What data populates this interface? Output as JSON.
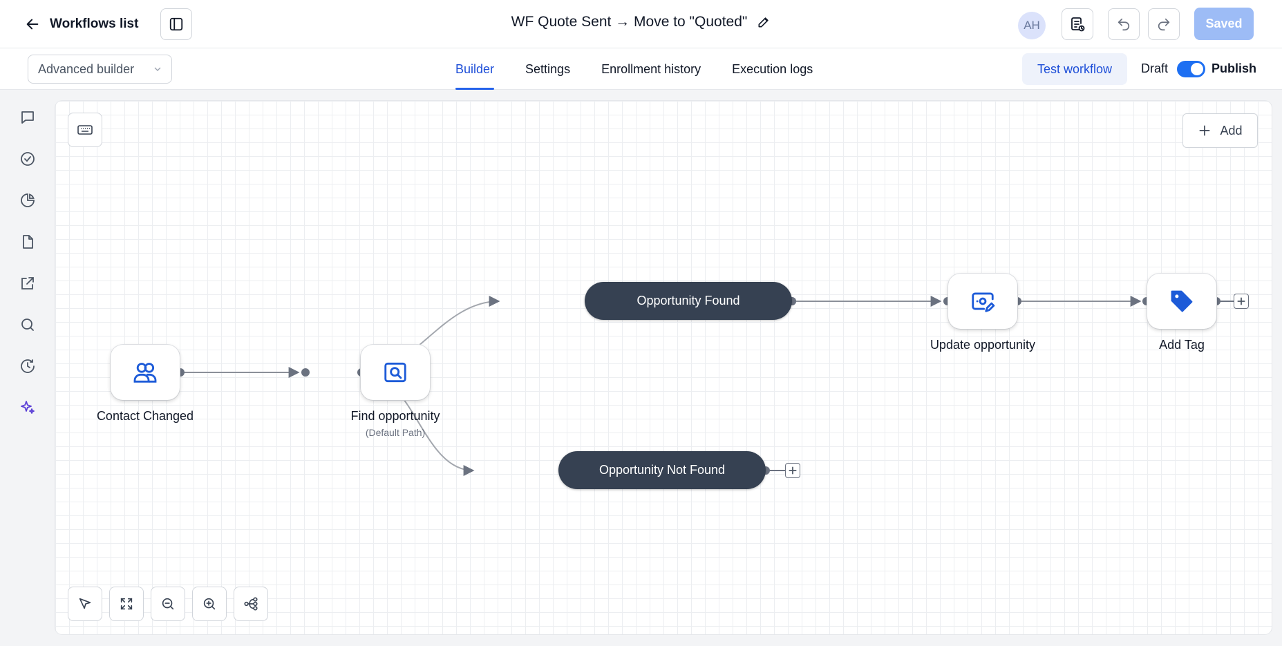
{
  "header": {
    "back_label": "Workflows list",
    "title": "WF Quote Sent → Move to \"Quoted\"",
    "avatar_initials": "AH",
    "saved_label": "Saved"
  },
  "subbar": {
    "builder_select_value": "Advanced builder",
    "tabs": [
      {
        "label": "Builder",
        "active": true
      },
      {
        "label": "Settings",
        "active": false
      },
      {
        "label": "Enrollment history",
        "active": false
      },
      {
        "label": "Execution logs",
        "active": false
      }
    ],
    "test_label": "Test workflow",
    "draft_label": "Draft",
    "publish_label": "Publish",
    "published": true
  },
  "rail": {
    "items": [
      "chat-icon",
      "check-circle-icon",
      "pie-chart-icon",
      "document-icon",
      "external-link-icon",
      "search-icon",
      "clock-history-icon",
      "sparkle-ai-icon"
    ]
  },
  "canvas": {
    "add_label": "Add",
    "nodes": {
      "contact_changed": {
        "label": "Contact Changed",
        "icon": "users-icon"
      },
      "find_opportunity": {
        "label": "Find opportunity",
        "sublabel": "(Default Path)",
        "icon": "search-frame-icon"
      },
      "update_opportunity": {
        "label": "Update opportunity",
        "icon": "edit-frame-icon"
      },
      "add_tag": {
        "label": "Add Tag",
        "icon": "tag-icon"
      }
    },
    "branches": {
      "found": "Opportunity Found",
      "not_found": "Opportunity Not Found"
    },
    "toolbar": [
      "pointer-icon",
      "fit-view-icon",
      "zoom-out-icon",
      "zoom-in-icon",
      "auto-layout-icon"
    ]
  },
  "colors": {
    "accent": "#2563eb",
    "branch_bg": "#364152",
    "saved_bg": "#9dbcf6",
    "edge": "#9ca3af"
  }
}
